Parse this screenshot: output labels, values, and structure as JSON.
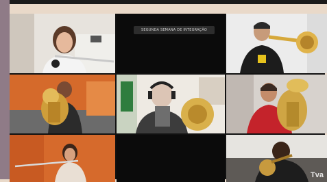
{
  "call": {
    "tiles": [
      {
        "name": "tile-flute-player"
      },
      {
        "name": "tile-screen-share"
      },
      {
        "name": "tile-trumpet-player"
      },
      {
        "name": "tile-euphonium-player"
      },
      {
        "name": "tile-horn-player"
      },
      {
        "name": "tile-tuba-player"
      },
      {
        "name": "tile-flute-player-2"
      },
      {
        "name": "tile-empty"
      },
      {
        "name": "tile-brass-player"
      }
    ],
    "screen_share_caption": "SEGUNDA SEMANA DE INTEGRAÇÃO",
    "corner_badge": "Tva"
  },
  "colors": {
    "background": "#e9d9c9",
    "tile_dark": "#111111",
    "orange_wall": "#d56a2b"
  }
}
